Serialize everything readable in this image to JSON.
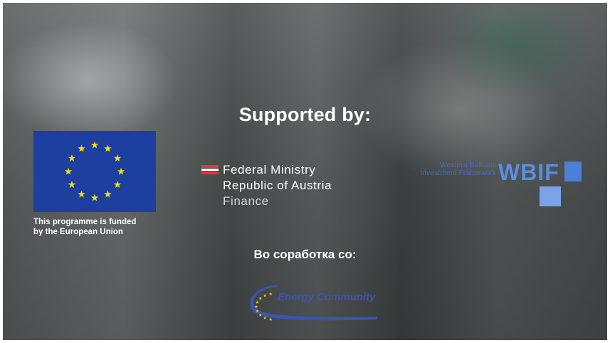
{
  "headline": "Supported by:",
  "eu": {
    "caption_line1": "This programme is funded",
    "caption_line2": "by the European Union",
    "flag_color": "#1c3fa0",
    "star_color": "#ffdd00"
  },
  "austria": {
    "line1": "Federal Ministry",
    "line2": "Republic of Austria",
    "line3": "Finance",
    "flag_color": "#e8323c"
  },
  "wbif": {
    "small_line1": "Western Balkans",
    "small_line2": "Investment Framework",
    "acronym": "WBIF",
    "color": "#4e7fd6"
  },
  "collaboration": "Во соработка со:",
  "energy_community": {
    "label": "Energy Community",
    "color": "#3a55b0"
  }
}
